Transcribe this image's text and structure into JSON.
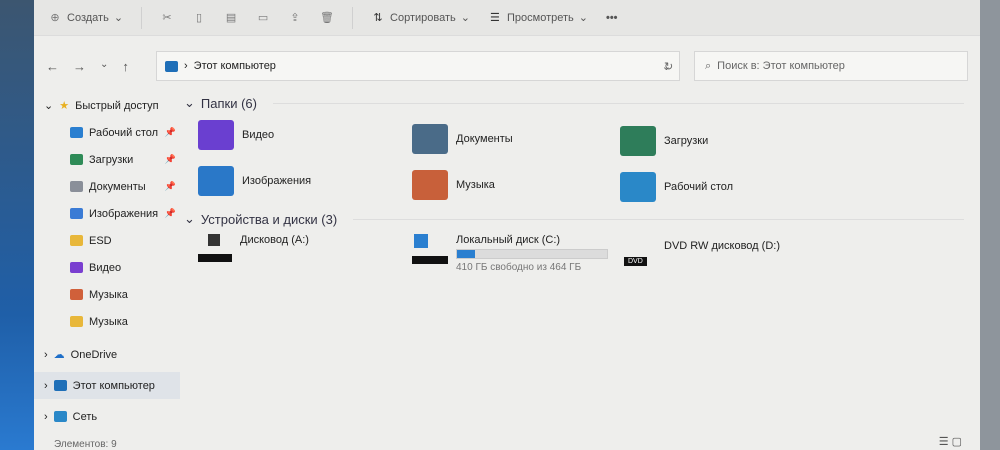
{
  "toolbar": {
    "new_label": "Создать",
    "sort_label": "Сортировать",
    "view_label": "Просмотреть",
    "more": "•••"
  },
  "address": {
    "path": "Этот компьютер",
    "search_placeholder": "Поиск в: Этот компьютер"
  },
  "sidebar": {
    "quick_access": "Быстрый доступ",
    "items": [
      {
        "label": "Рабочий стол",
        "color": "#2a7fd0",
        "pinned": true
      },
      {
        "label": "Загрузки",
        "color": "#2e8b57",
        "pinned": true
      },
      {
        "label": "Документы",
        "color": "#8a8f99",
        "pinned": true
      },
      {
        "label": "Изображения",
        "color": "#3a7bd5",
        "pinned": true
      },
      {
        "label": "ESD",
        "color": "#e8b73a",
        "pinned": false
      },
      {
        "label": "Видео",
        "color": "#7a3fd0",
        "pinned": false
      },
      {
        "label": "Музыка",
        "color": "#d0603a",
        "pinned": false
      },
      {
        "label": "Музыка",
        "color": "#e8b73a",
        "pinned": false
      }
    ],
    "onedrive": "OneDrive",
    "this_pc": "Этот компьютер",
    "network": "Сеть"
  },
  "main": {
    "folders_header": "Папки (6)",
    "folders": [
      {
        "label": "Видео",
        "color": "#6a3fd0"
      },
      {
        "label": "Документы",
        "color": "#4a6b88"
      },
      {
        "label": "Загрузки",
        "color": "#2e7d5a"
      },
      {
        "label": "Изображения",
        "color": "#2a78c8"
      },
      {
        "label": "Музыка",
        "color": "#c8603a"
      },
      {
        "label": "Рабочий стол",
        "color": "#2a88c8"
      }
    ],
    "devices_header": "Устройства и диски (3)",
    "drives": [
      {
        "label": "Дисковод (A:)"
      },
      {
        "label": "Локальный диск (C:)",
        "free_text": "410 ГБ свободно из 464 ГБ",
        "used_percent": 12
      },
      {
        "label": "DVD RW дисковод (D:)",
        "badge": "DVD"
      }
    ]
  },
  "status": {
    "count": "Элементов: 9"
  }
}
